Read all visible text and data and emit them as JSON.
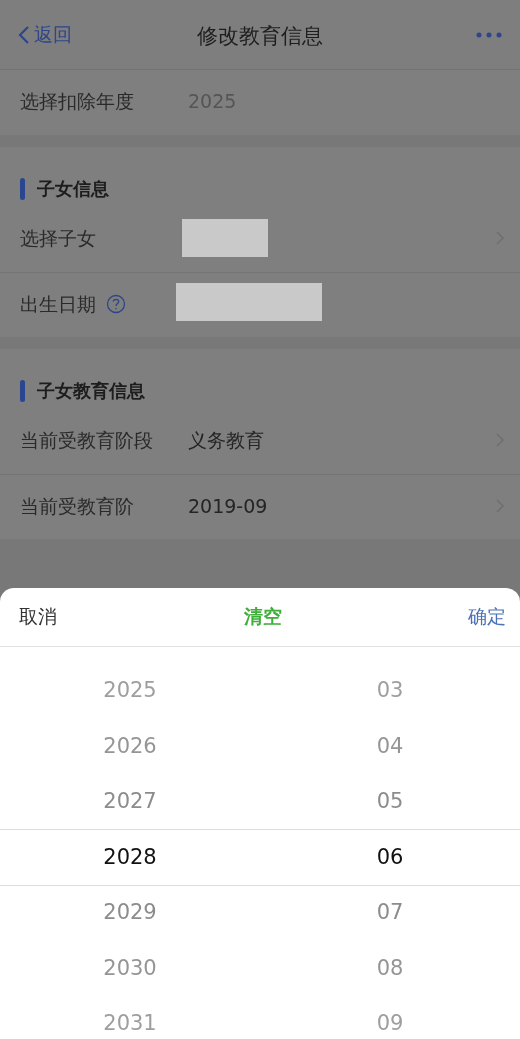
{
  "nav": {
    "back": "返回",
    "title": "修改教育信息"
  },
  "fields": [
    {
      "kind": "text",
      "label": "选择扣除年度",
      "value": "2025",
      "chevron": false,
      "help": false
    }
  ],
  "sections": [
    {
      "title": "子女信息",
      "rows": [
        {
          "kind": "redacted",
          "label": "选择子女",
          "chevron": true,
          "help": false
        },
        {
          "kind": "redacted",
          "label": "出生日期",
          "chevron": false,
          "help": true
        }
      ]
    },
    {
      "title": "子女教育信息",
      "rows": [
        {
          "kind": "text",
          "label": "当前受教育阶段",
          "value": "义务教育",
          "chevron": true,
          "help": false
        },
        {
          "kind": "text",
          "label": "当前受教育阶",
          "value": "2019-09",
          "chevron": true,
          "help": false
        }
      ]
    }
  ],
  "picker": {
    "cancel": "取消",
    "clear": "清空",
    "confirm": "确定",
    "years": [
      {
        "label": "2025",
        "selected": false
      },
      {
        "label": "2026",
        "selected": false
      },
      {
        "label": "2027",
        "selected": false
      },
      {
        "label": "2028",
        "selected": true
      },
      {
        "label": "2029",
        "selected": false
      },
      {
        "label": "2030",
        "selected": false
      },
      {
        "label": "2031",
        "selected": false
      }
    ],
    "months": [
      {
        "label": "03",
        "selected": false
      },
      {
        "label": "04",
        "selected": false
      },
      {
        "label": "05",
        "selected": false
      },
      {
        "label": "06",
        "selected": true
      },
      {
        "label": "07",
        "selected": false
      },
      {
        "label": "08",
        "selected": false
      },
      {
        "label": "09",
        "selected": false
      }
    ]
  }
}
